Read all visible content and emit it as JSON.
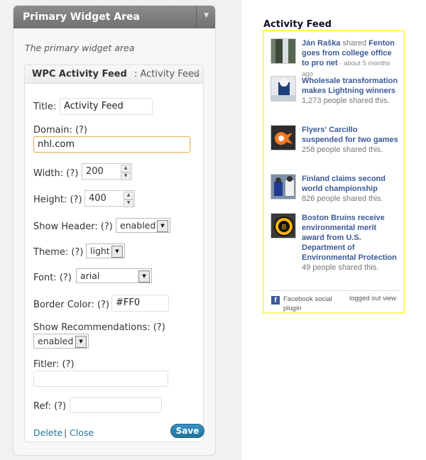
{
  "widget_area": {
    "title": "Primary Widget Area",
    "description": "The primary widget area"
  },
  "widget": {
    "name": "WPC Activity Feed",
    "subtitle": ": Activity Feed",
    "fields": {
      "title_label": "Title:",
      "title_value": "Activity Feed",
      "domain_label": "Domain: (?)",
      "domain_value": "nhl.com",
      "width_label": "Width: (?)",
      "width_value": "200",
      "height_label": "Height: (?)",
      "height_value": "400",
      "show_header_label": "Show Header: (?)",
      "show_header_value": "enabled",
      "theme_label": "Theme: (?)",
      "theme_value": "light",
      "font_label": "Font: (?)",
      "font_value": "arial",
      "border_color_label": "Border Color: (?)",
      "border_color_value": "#FF0",
      "show_recommendations_label": "Show Recommendations: (?)",
      "show_recommendations_value": "enabled",
      "filter_label": "Fitler: (?)",
      "filter_value": "",
      "ref_label": "Ref: (?)",
      "ref_value": ""
    },
    "actions": {
      "delete": "Delete",
      "separator": "|",
      "close": "Close",
      "save": "Save"
    }
  },
  "feed": {
    "title": "Activity Feed",
    "border_color": "#FFFF55",
    "items": [
      {
        "author": "Ján Raška",
        "verb": " shared ",
        "headline": "Fenton goes from college office to pro net",
        "meta": " · about 5 months ago",
        "thumb_icon": "waterfall-photo-icon"
      },
      {
        "headline": "Wholesale transformation makes Lightning winners",
        "meta": "1,273 people shared this.",
        "thumb_icon": "hockey-goalie-photo-icon"
      },
      {
        "headline": "Flyers' Carcillo suspended for two games",
        "meta": "258 people shared this.",
        "thumb_icon": "flyers-logo-icon"
      },
      {
        "headline": "Finland claims second world championship",
        "meta": "826 people shared this.",
        "thumb_icon": "hockey-players-photo-icon"
      },
      {
        "headline": "Boston Bruins receive environmental merit award from U.S. Department of Environmental Protection",
        "meta": "49 people shared this.",
        "thumb_icon": "bruins-logo-icon"
      }
    ],
    "footer": {
      "plugin_text": "Facebook social plugin",
      "logout_text": "logged out view",
      "fb_glyph": "f"
    }
  }
}
